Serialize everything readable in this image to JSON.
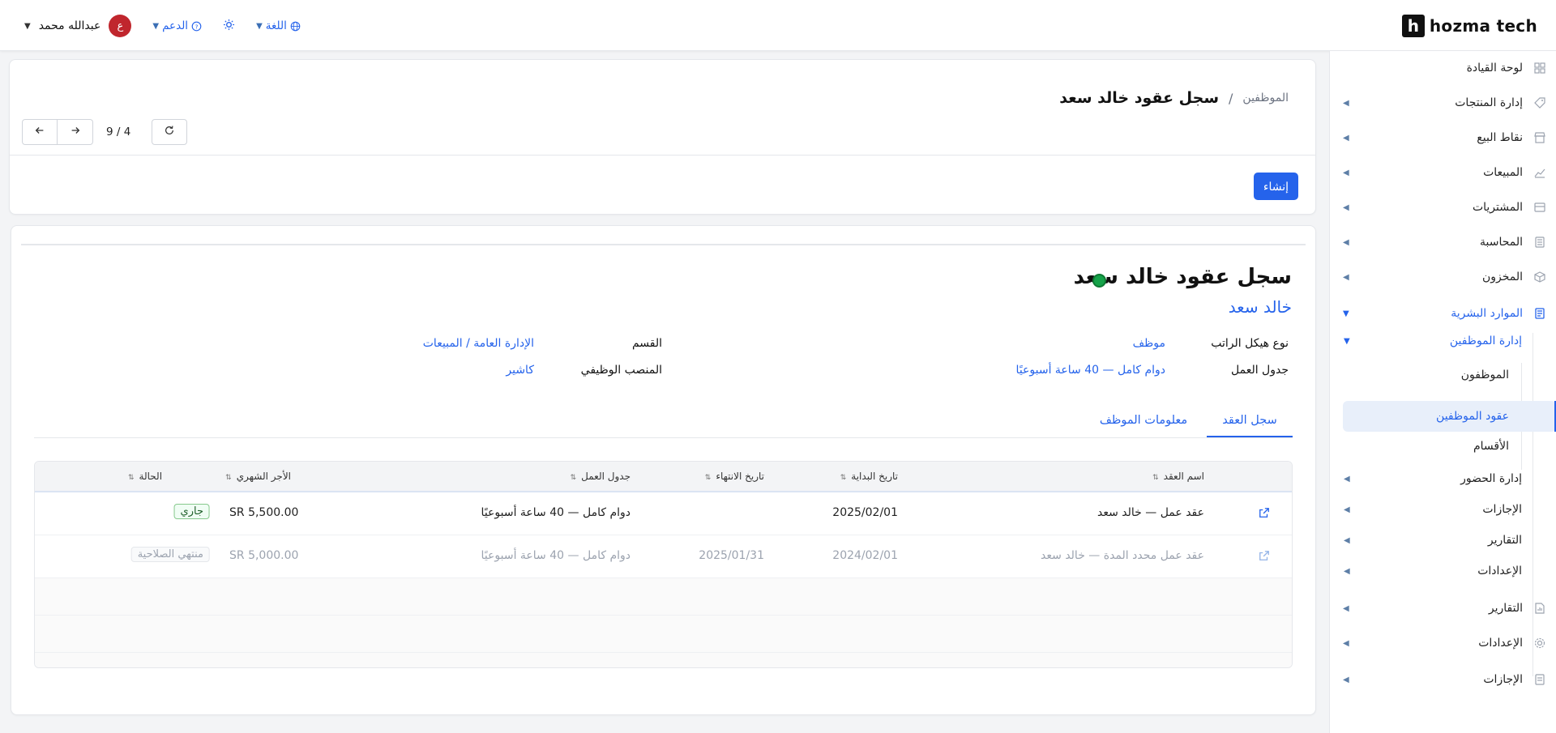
{
  "brand": {
    "mark": "h",
    "name": "hozma tech"
  },
  "topbar": {
    "user_name": "عبدالله محمد",
    "avatar_letter": "ع",
    "support_label": "الدعم",
    "language_label": "اللغة"
  },
  "sidebar": {
    "items": [
      {
        "label": "لوحة القيادة",
        "icon": "dashboard-icon"
      },
      {
        "label": "إدارة المنتجات",
        "icon": "tag-icon"
      },
      {
        "label": "نقاط البيع",
        "icon": "store-icon"
      },
      {
        "label": "المبيعات",
        "icon": "chart-line-icon"
      },
      {
        "label": "المشتريات",
        "icon": "inbox-icon"
      },
      {
        "label": "المحاسبة",
        "icon": "calculator-icon"
      },
      {
        "label": "المخزون",
        "icon": "box-icon"
      },
      {
        "label": "الموارد البشرية",
        "icon": "document-icon"
      },
      {
        "label": "التقارير",
        "icon": "report-icon"
      },
      {
        "label": "الإعدادات",
        "icon": "gear-icon"
      },
      {
        "label": "الإجازات",
        "icon": "list-icon"
      }
    ],
    "hr_sub": {
      "employee_management": "إدارة الموظفين",
      "employees": "الموظفون",
      "employee_contracts": "عقود الموظفين",
      "departments": "الأقسام",
      "attendance": "إدارة الحضور",
      "leaves": "الإجازات",
      "reports": "التقارير",
      "settings": "الإعدادات"
    }
  },
  "header": {
    "breadcrumb_parent": "الموظفين",
    "breadcrumb_sep": "/",
    "title": "سجل عقود خالد سعد",
    "pager": "4 / 9",
    "create_label": "إنشاء"
  },
  "form": {
    "title": "سجل عقود خالد سعد",
    "employee_name": "خالد سعد",
    "status_color": "#16a34a",
    "fields": {
      "salary_structure_label": "نوع هيكل الراتب",
      "salary_structure_value": "موظف",
      "schedule_label": "جدول العمل",
      "schedule_value": "دوام كامل — 40 ساعة أسبوعيًا",
      "department_label": "القسم",
      "department_value": "الإدارة العامة / المبيعات",
      "job_label": "المنصب الوظيفي",
      "job_value": "كاشير"
    },
    "tabs": {
      "contract_history": "سجل العقد",
      "employee_info": "معلومات الموظف"
    }
  },
  "table": {
    "headers": {
      "name": "اسم العقد",
      "start": "تاريخ البداية",
      "end": "تاريخ الانتهاء",
      "schedule": "جدول العمل",
      "wage": "الأجر الشهري",
      "status": "الحالة"
    },
    "rows": [
      {
        "name": "عقد عمل — خالد سعد",
        "start": "2025/02/01",
        "end": "",
        "schedule": "دوام كامل — 40 ساعة أسبوعيًا",
        "wage": "SR 5,500.00",
        "status": "جاري"
      },
      {
        "name": "عقد عمل محدد المدة — خالد سعد",
        "start": "2024/02/01",
        "end": "2025/01/31",
        "schedule": "دوام كامل — 40 ساعة أسبوعيًا",
        "wage": "SR 5,000.00",
        "status": "منتهي الصلاحية"
      }
    ]
  },
  "colors": {
    "accent": "#2563eb",
    "danger": "#c0262d",
    "success": "#16a34a"
  }
}
